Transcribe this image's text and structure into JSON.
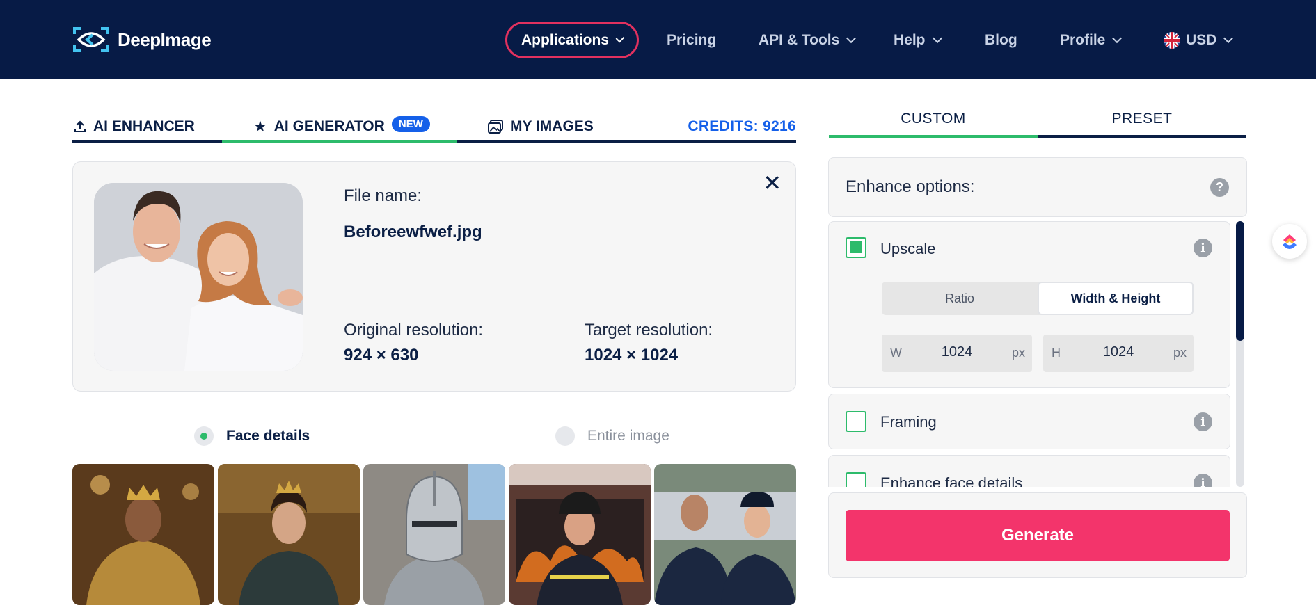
{
  "brand": {
    "name": "DeepImage"
  },
  "nav": {
    "applications": "Applications",
    "pricing": "Pricing",
    "api_tools": "API & Tools",
    "help": "Help",
    "blog": "Blog",
    "profile": "Profile",
    "currency": "USD"
  },
  "tabs": {
    "enhancer": "AI ENHANCER",
    "generator": "AI GENERATOR",
    "generator_badge": "NEW",
    "my_images": "MY IMAGES",
    "credits": "CREDITS: 9216"
  },
  "file": {
    "name_label": "File name:",
    "name": "Beforeewfwef.jpg",
    "orig_label": "Original resolution:",
    "orig_value": "924 × 630",
    "target_label": "Target resolution:",
    "target_value": "1024 × 1024"
  },
  "mode": {
    "face": "Face details",
    "entire": "Entire image",
    "selected": "face"
  },
  "gallery": [
    "king",
    "queen",
    "knight",
    "firefighter",
    "police"
  ],
  "right": {
    "tab_custom": "CUSTOM",
    "tab_preset": "PRESET",
    "enhance_title": "Enhance options:",
    "upscale": "Upscale",
    "ratio": "Ratio",
    "width_height": "Width & Height",
    "w_prefix": "W",
    "w_value": "1024",
    "h_prefix": "H",
    "h_value": "1024",
    "unit": "px",
    "framing": "Framing",
    "face_details": "Enhance face details",
    "generate": "Generate"
  },
  "colors": {
    "navy": "#071b46",
    "accent_pink": "#f3346b",
    "green": "#2dbb6b",
    "blue": "#1560e9"
  }
}
